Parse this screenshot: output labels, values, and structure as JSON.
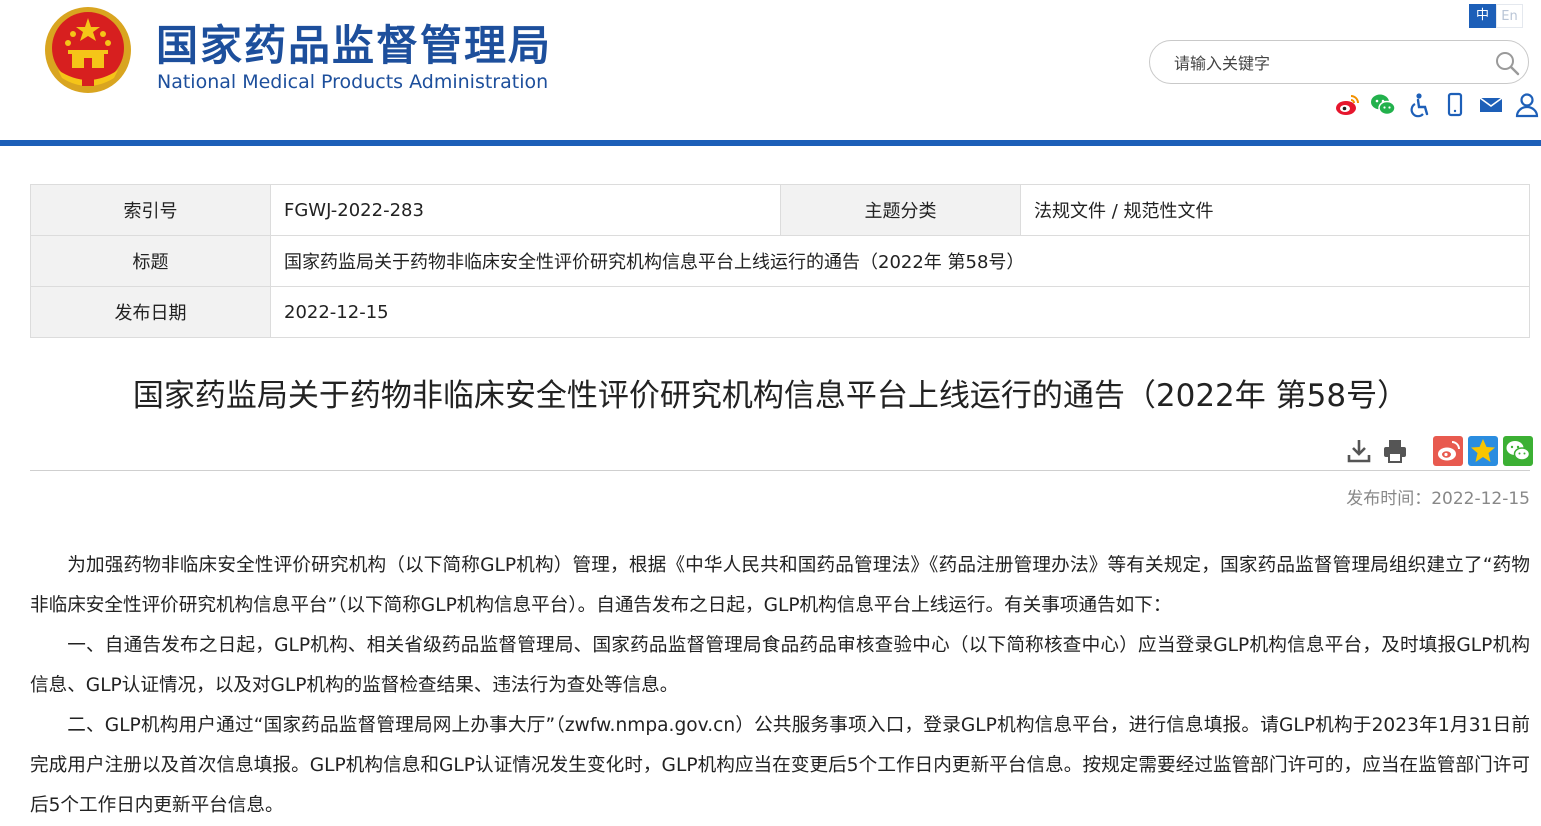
{
  "header": {
    "site_title_cn": "国家药品监督管理局",
    "site_title_en": "National Medical Products Administration",
    "lang_cn": "中",
    "lang_en": "En",
    "search_placeholder": "请输入关键字",
    "brand_color": "#1d5fb8",
    "icons": [
      "weibo-icon",
      "wechat-icon",
      "accessibility-icon",
      "mobile-icon",
      "mail-icon",
      "user-icon"
    ]
  },
  "meta": {
    "index_label": "索引号",
    "index_value": "FGWJ-2022-283",
    "category_label": "主题分类",
    "category_value": "法规文件 / 规范性文件",
    "title_label": "标题",
    "title_value": "国家药监局关于药物非临床安全性评价研究机构信息平台上线运行的通告（2022年 第58号）",
    "date_label": "发布日期",
    "date_value": "2022-12-15"
  },
  "article": {
    "title": "国家药监局关于药物非临床安全性评价研究机构信息平台上线运行的通告（2022年 第58号）",
    "publish_time": "发布时间：2022-12-15",
    "paragraphs": [
      "为加强药物非临床安全性评价研究机构（以下简称GLP机构）管理，根据《中华人民共和国药品管理法》《药品注册管理办法》等有关规定，国家药品监督管理局组织建立了“药物非临床安全性评价研究机构信息平台”（以下简称GLP机构信息平台）。自通告发布之日起，GLP机构信息平台上线运行。有关事项通告如下：",
      "一、自通告发布之日起，GLP机构、相关省级药品监督管理局、国家药品监督管理局食品药品审核查验中心（以下简称核查中心）应当登录GLP机构信息平台，及时填报GLP机构信息、GLP认证情况，以及对GLP机构的监督检查结果、违法行为查处等信息。",
      "二、GLP机构用户通过“国家药品监督管理局网上办事大厅”（zwfw.nmpa.gov.cn）公共服务事项入口，登录GLP机构信息平台，进行信息填报。请GLP机构于2023年1月31日前完成用户注册以及首次信息填报。GLP机构信息和GLP认证情况发生变化时，GLP机构应当在变更后5个工作日内更新平台信息。按规定需要经过监管部门许可的，应当在监管部门许可后5个工作日内更新平台信息。"
    ]
  }
}
